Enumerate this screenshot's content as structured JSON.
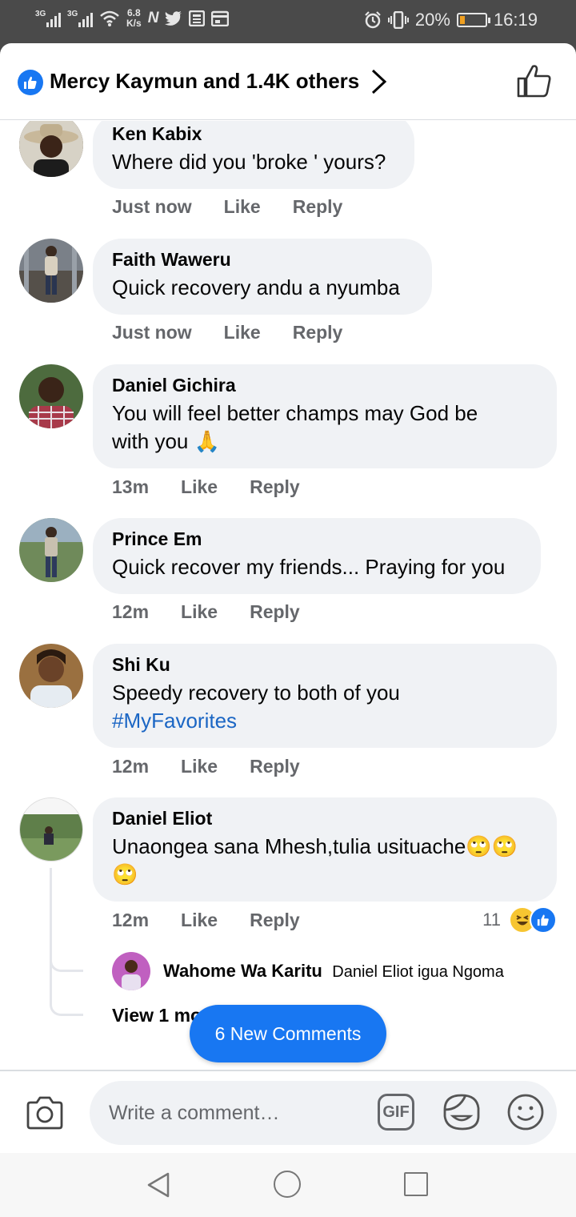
{
  "status_bar": {
    "net1": "3G",
    "net2": "3G",
    "speed_value": "6.8",
    "speed_unit": "K/s",
    "app_icons": [
      "N",
      "twitter-icon",
      "news-icon",
      "calendar-icon"
    ],
    "battery_percent": "20%",
    "battery_level": 0.2,
    "time": "16:19"
  },
  "header": {
    "reactors": "Mercy Kaymun and 1.4K others"
  },
  "comments": [
    {
      "author": "Ken Kabix",
      "text": "Where did you 'broke ' yours?",
      "time": "Just now",
      "like": "Like",
      "reply": "Reply"
    },
    {
      "author": "Faith Waweru",
      "text": "Quick recovery andu a nyumba",
      "time": "Just now",
      "like": "Like",
      "reply": "Reply"
    },
    {
      "author": "Daniel Gichira",
      "text_line1": "You will feel better  champs may God be",
      "text_line2": "with you 🙏",
      "time": "13m",
      "like": "Like",
      "reply": "Reply"
    },
    {
      "author": "Prince Em",
      "text": "Quick recover my friends... Praying for you",
      "time": "12m",
      "like": "Like",
      "reply": "Reply"
    },
    {
      "author": "Shi Ku",
      "text": "Speedy recovery to both of you",
      "hashtag": "#MyFavorites",
      "time": "12m",
      "like": "Like",
      "reply": "Reply"
    },
    {
      "author": "Daniel Eliot",
      "text_line1": "Unaongea sana Mhesh,tulia usituache🙄🙄",
      "text_line2": "🙄",
      "time": "12m",
      "like": "Like",
      "reply": "Reply",
      "reaction_count": "11",
      "reply_preview": {
        "author": "Wahome Wa Karitu",
        "text": "Daniel Eliot igua Ngoma"
      },
      "view_more": "View 1 more reply"
    }
  ],
  "new_comments_button": "6 New Comments",
  "composer": {
    "placeholder": "Write a comment…",
    "gif_label": "GIF"
  },
  "colors": {
    "accent": "#1877f2",
    "bubble": "#f0f2f5",
    "meta": "#65676b",
    "hashtag": "#1b66c4"
  }
}
